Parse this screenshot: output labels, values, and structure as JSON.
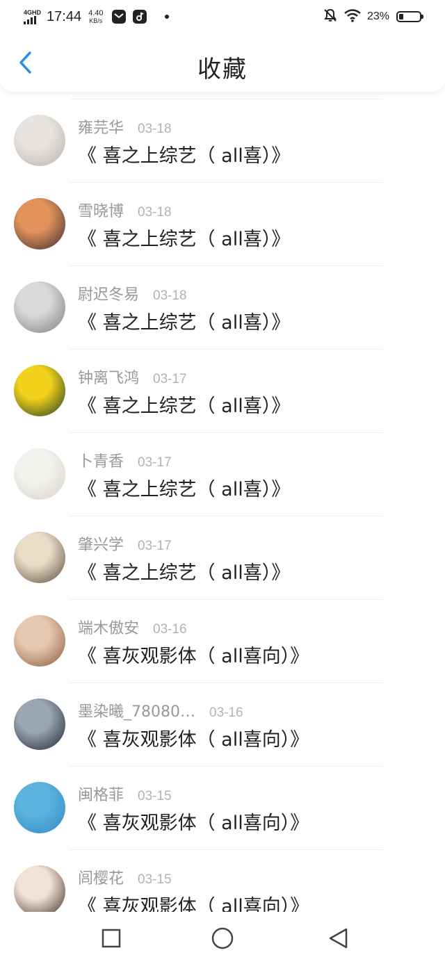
{
  "status_bar": {
    "network": "4GHD",
    "time": "17:44",
    "speed_value": "4.40",
    "speed_unit": "KB/s",
    "battery_percent": "23%",
    "battery_level": 0.23
  },
  "header": {
    "back_icon": "chevron-left-icon",
    "title": "收藏"
  },
  "favorites": [
    {
      "name": "雍芫华",
      "date": "03-18",
      "title": "《 喜之上综艺（ all喜）》",
      "avatar_colors": [
        "#e8e4e0",
        "#b9b2a9"
      ]
    },
    {
      "name": "雪晓博",
      "date": "03-18",
      "title": "《 喜之上综艺（ all喜）》",
      "avatar_colors": [
        "#e2925b",
        "#3b2a2f"
      ]
    },
    {
      "name": "尉迟冬易",
      "date": "03-18",
      "title": "《 喜之上综艺（ all喜）》",
      "avatar_colors": [
        "#d9d9d9",
        "#7a7a7a"
      ]
    },
    {
      "name": "钟离飞鸿",
      "date": "03-17",
      "title": "《 喜之上综艺（ all喜）》",
      "avatar_colors": [
        "#f2d21b",
        "#1f3a1e"
      ]
    },
    {
      "name": "卜青香",
      "date": "03-17",
      "title": "《 喜之上综艺（ all喜）》",
      "avatar_colors": [
        "#f4f2ee",
        "#d6d2cb"
      ]
    },
    {
      "name": "肇兴学",
      "date": "03-17",
      "title": "《 喜之上综艺（ all喜）》",
      "avatar_colors": [
        "#e9ddc8",
        "#5a4a3a"
      ]
    },
    {
      "name": "端木傲安",
      "date": "03-16",
      "title": "《 喜灰观影体（ all喜向）》",
      "avatar_colors": [
        "#e6c7b0",
        "#8a5a3a"
      ]
    },
    {
      "name": "墨染曦_78080…",
      "date": "03-16",
      "title": "《 喜灰观影体（ all喜向）》",
      "avatar_colors": [
        "#9aa6b2",
        "#1c2430"
      ]
    },
    {
      "name": "闽格菲",
      "date": "03-15",
      "title": "《 喜灰观影体（ all喜向）》",
      "avatar_colors": [
        "#5cb3de",
        "#2f88c2"
      ]
    },
    {
      "name": "闾樱花",
      "date": "03-15",
      "title": "《 喜灰观影体（ all喜向）》",
      "avatar_colors": [
        "#f3e3d6",
        "#3a2a22"
      ]
    }
  ],
  "nav": {
    "recent_icon": "square-icon",
    "home_icon": "circle-icon",
    "back_icon": "triangle-back-icon"
  },
  "colors": {
    "accent": "#2b8fe6",
    "text_primary": "#222222",
    "text_secondary": "#999999"
  }
}
